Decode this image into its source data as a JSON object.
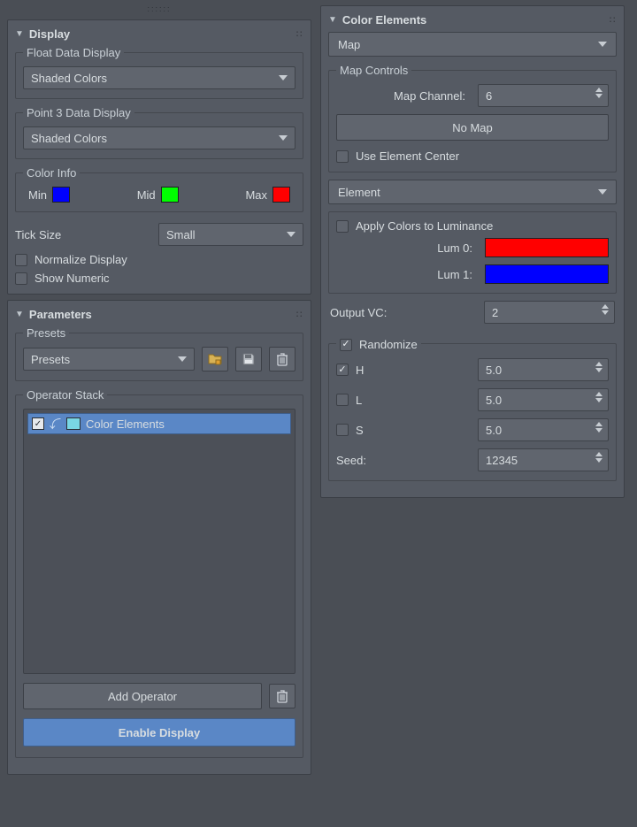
{
  "display": {
    "title": "Display",
    "floatData": {
      "legend": "Float Data Display",
      "value": "Shaded Colors"
    },
    "point3Data": {
      "legend": "Point 3 Data Display",
      "value": "Shaded Colors"
    },
    "colorInfo": {
      "legend": "Color Info",
      "minLabel": "Min",
      "minColor": "#0000ff",
      "midLabel": "Mid",
      "midColor": "#00ff00",
      "maxLabel": "Max",
      "maxColor": "#ff0000"
    },
    "tickSize": {
      "label": "Tick Size",
      "value": "Small"
    },
    "normalize": {
      "label": "Normalize Display",
      "checked": false
    },
    "showNumeric": {
      "label": "Show Numeric",
      "checked": false
    }
  },
  "parameters": {
    "title": "Parameters",
    "presets": {
      "legend": "Presets",
      "value": "Presets"
    },
    "operatorStack": {
      "legend": "Operator Stack",
      "items": [
        {
          "label": "Color Elements",
          "checked": true,
          "swatch": "#79d6e4"
        }
      ],
      "addLabel": "Add Operator",
      "enableLabel": "Enable Display"
    }
  },
  "colorElements": {
    "title": "Color Elements",
    "mapSelector": "Map",
    "mapControls": {
      "legend": "Map Controls",
      "channelLabel": "Map Channel:",
      "channelValue": "6",
      "noMapLabel": "No Map",
      "useCenter": {
        "label": "Use Element Center",
        "checked": false
      }
    },
    "elementSelector": "Element",
    "luminance": {
      "applyLabel": "Apply Colors to Luminance",
      "applyChecked": false,
      "lum0Label": "Lum 0:",
      "lum0Color": "#ff0000",
      "lum1Label": "Lum 1:",
      "lum1Color": "#0000ff"
    },
    "outputVC": {
      "label": "Output VC:",
      "value": "2"
    },
    "randomize": {
      "legend": "Randomize",
      "legendChecked": true,
      "h": {
        "label": "H",
        "checked": true,
        "value": "5.0"
      },
      "l": {
        "label": "L",
        "checked": false,
        "value": "5.0"
      },
      "s": {
        "label": "S",
        "checked": false,
        "value": "5.0"
      },
      "seed": {
        "label": "Seed:",
        "value": "12345"
      }
    }
  }
}
